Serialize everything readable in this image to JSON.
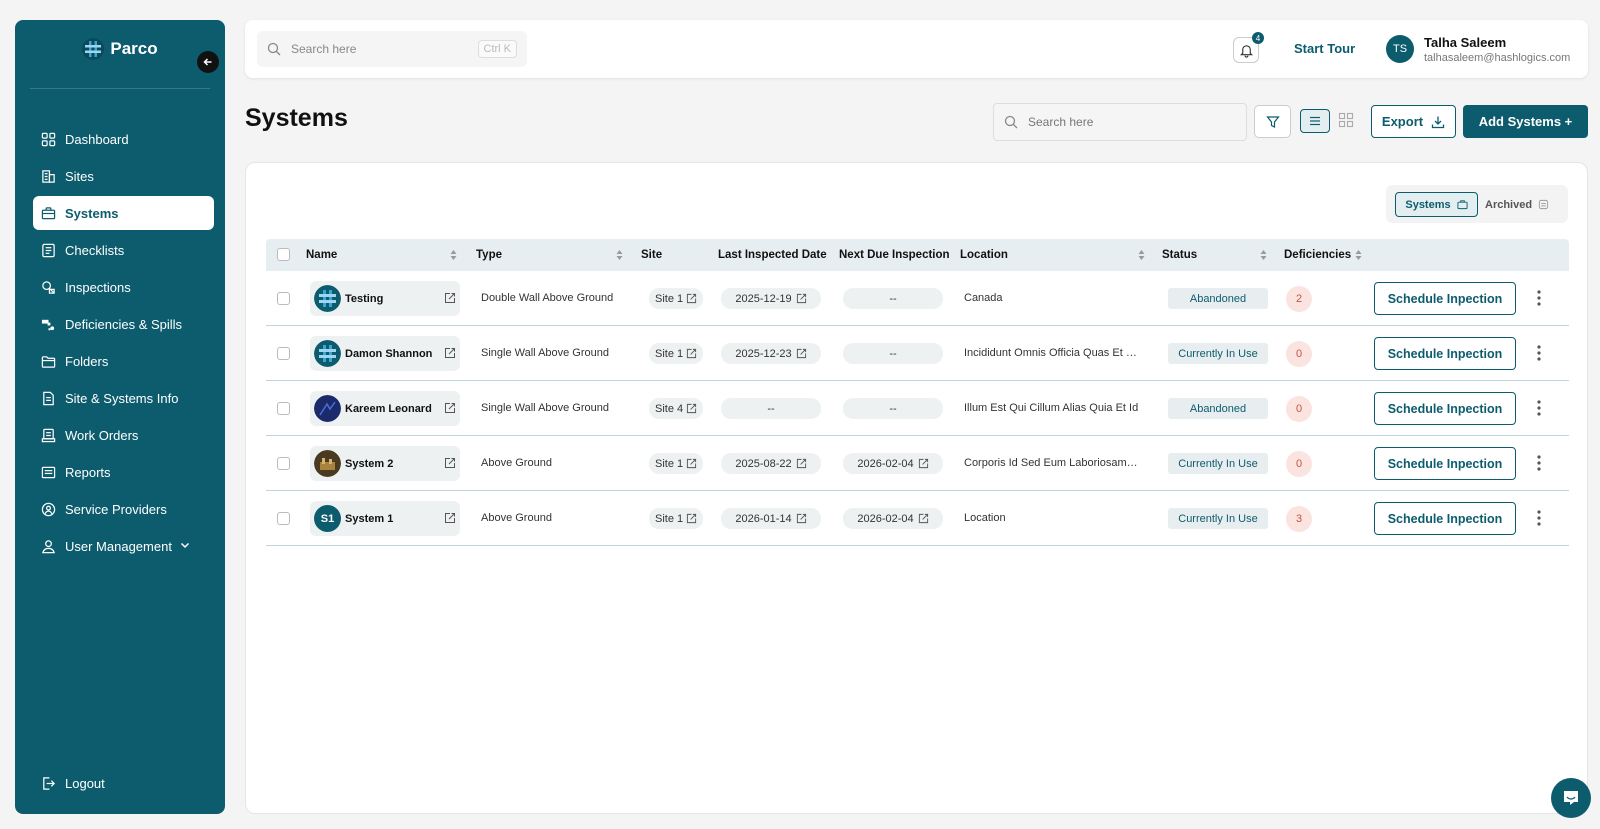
{
  "app": {
    "name": "Parco"
  },
  "sidebar": {
    "items": [
      {
        "label": "Dashboard",
        "icon": "dashboard-icon"
      },
      {
        "label": "Sites",
        "icon": "building-icon"
      },
      {
        "label": "Systems",
        "icon": "briefcase-icon",
        "active": true
      },
      {
        "label": "Checklists",
        "icon": "checklist-icon"
      },
      {
        "label": "Inspections",
        "icon": "inspection-icon"
      },
      {
        "label": "Deficiencies & Spills",
        "icon": "spill-icon"
      },
      {
        "label": "Folders",
        "icon": "folder-icon"
      },
      {
        "label": "Site & Systems Info",
        "icon": "document-icon"
      },
      {
        "label": "Work Orders",
        "icon": "work-order-icon"
      },
      {
        "label": "Reports",
        "icon": "report-icon"
      },
      {
        "label": "Service Providers",
        "icon": "service-icon"
      },
      {
        "label": "User Management",
        "icon": "user-icon"
      }
    ],
    "logout": "Logout"
  },
  "topbar": {
    "search_placeholder": "Search here",
    "shortcut": "Ctrl K",
    "notification_count": "4",
    "start_tour": "Start Tour",
    "user": {
      "initials": "TS",
      "name": "Talha Saleem",
      "email": "talhasaleem@hashlogics.com"
    }
  },
  "page": {
    "title": "Systems",
    "search_placeholder": "Search here",
    "export_label": "Export",
    "add_label": "Add Systems +"
  },
  "toggle": {
    "systems": "Systems",
    "archived": "Archived"
  },
  "table": {
    "columns": {
      "name": "Name",
      "type": "Type",
      "site": "Site",
      "last_inspected": "Last Inspected Date",
      "next_due": "Next Due Inspection",
      "location": "Location",
      "status": "Status",
      "deficiencies": "Deficiencies"
    },
    "action_label": "Schedule Inpection",
    "rows": [
      {
        "name": "Testing",
        "thumb": "logo",
        "type": "Double Wall Above Ground",
        "site": "Site 1",
        "last": "2025-12-19",
        "next": "--",
        "location": "Canada",
        "status": "Abandoned",
        "deficiencies": "2"
      },
      {
        "name": "Damon Shannon",
        "thumb": "logo",
        "type": "Single Wall Above Ground",
        "site": "Site 1",
        "last": "2025-12-23",
        "next": "--",
        "location": "Incididunt Omnis Officia Quas Et Sed",
        "status": "Currently In Use",
        "deficiencies": "0"
      },
      {
        "name": "Kareem Leonard",
        "thumb": "dark",
        "type": "Single Wall Above Ground",
        "site": "Site 4",
        "last": "--",
        "next": "--",
        "location": "Illum Est Qui Cillum Alias Quia Et Id",
        "status": "Abandoned",
        "deficiencies": "0"
      },
      {
        "name": "System 2",
        "thumb": "photo",
        "type": "Above Ground",
        "site": "Site 1",
        "last": "2025-08-22",
        "next": "2026-02-04",
        "location": "Corporis Id Sed Eum Laboriosam Ut",
        "status": "Currently In Use",
        "deficiencies": "0"
      },
      {
        "name": "System 1",
        "thumb": "S1",
        "type": "Above Ground",
        "site": "Site 1",
        "last": "2026-01-14",
        "next": "2026-02-04",
        "location": "Location",
        "status": "Currently In Use",
        "deficiencies": "3"
      }
    ]
  },
  "colors": {
    "primary": "#0d5c6e",
    "badge_bg": "#fbe3df",
    "badge_text": "#c0574a"
  }
}
